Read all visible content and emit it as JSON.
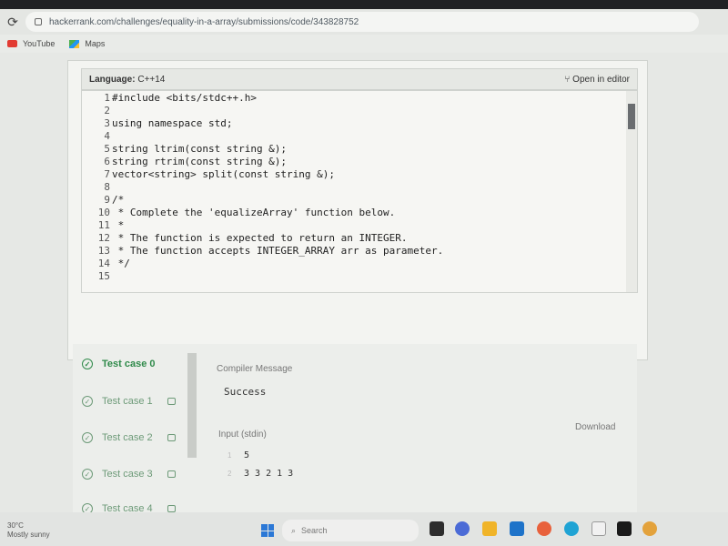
{
  "browser": {
    "url": "hackerrank.com/challenges/equality-in-a-array/submissions/code/343828752",
    "bookmarks": [
      {
        "label": "YouTube"
      },
      {
        "label": "Maps"
      }
    ]
  },
  "code_panel": {
    "language_label": "Language:",
    "language_value": "C++14",
    "open_in_editor": "Open in editor",
    "lines": [
      {
        "num": "1",
        "text": "#include <bits/stdc++.h>"
      },
      {
        "num": "2",
        "text": ""
      },
      {
        "num": "3",
        "text": "using namespace std;"
      },
      {
        "num": "4",
        "text": ""
      },
      {
        "num": "5",
        "text": "string ltrim(const string &);"
      },
      {
        "num": "6",
        "text": "string rtrim(const string &);"
      },
      {
        "num": "7",
        "text": "vector<string> split(const string &);"
      },
      {
        "num": "8",
        "text": ""
      },
      {
        "num": "9",
        "text": "/*"
      },
      {
        "num": "10",
        "text": " * Complete the 'equalizeArray' function below."
      },
      {
        "num": "11",
        "text": " *"
      },
      {
        "num": "12",
        "text": " * The function is expected to return an INTEGER."
      },
      {
        "num": "13",
        "text": " * The function accepts INTEGER_ARRAY arr as parameter."
      },
      {
        "num": "14",
        "text": " */"
      },
      {
        "num": "15",
        "text": ""
      }
    ]
  },
  "test_cases": [
    {
      "label": "Test case 0",
      "active": true,
      "locked": false
    },
    {
      "label": "Test case 1",
      "active": false,
      "locked": true
    },
    {
      "label": "Test case 2",
      "active": false,
      "locked": true
    },
    {
      "label": "Test case 3",
      "active": false,
      "locked": true
    },
    {
      "label": "Test case 4",
      "active": false,
      "locked": true
    }
  ],
  "result": {
    "compiler_message_label": "Compiler Message",
    "compiler_message": "Success",
    "input_label": "Input (stdin)",
    "download_label": "Download",
    "input_lines": [
      {
        "num": "1",
        "text": "5"
      },
      {
        "num": "2",
        "text": "3 3 2 1 3"
      }
    ]
  },
  "taskbar": {
    "weather_temp": "30°C",
    "weather_desc": "Mostly sunny",
    "search_placeholder": "Search"
  },
  "colors": {
    "accent_green": "#2f8a4a",
    "windows_blue": "#2b78d6"
  }
}
